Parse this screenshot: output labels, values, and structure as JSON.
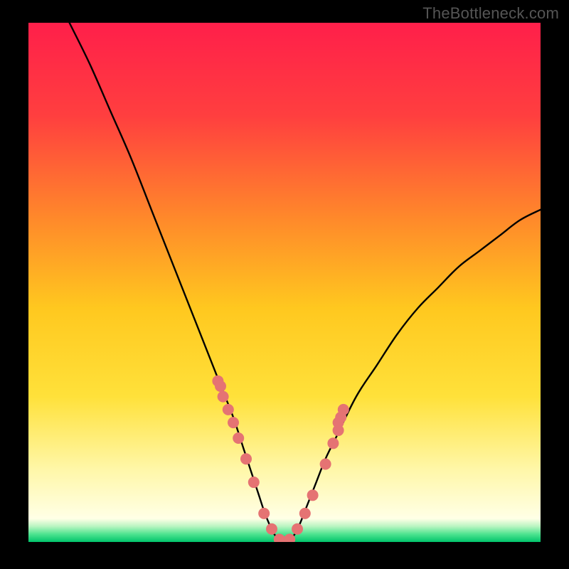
{
  "watermark": "TheBottleneck.com",
  "chart_data": {
    "type": "line",
    "title": "",
    "xlabel": "",
    "ylabel": "",
    "xlim": [
      0,
      100
    ],
    "ylim": [
      0,
      100
    ],
    "gradient_stops": [
      {
        "offset": 0.0,
        "color": "#ff1f4a"
      },
      {
        "offset": 0.18,
        "color": "#ff3f3f"
      },
      {
        "offset": 0.38,
        "color": "#ff8a2a"
      },
      {
        "offset": 0.55,
        "color": "#ffc81f"
      },
      {
        "offset": 0.72,
        "color": "#ffe13a"
      },
      {
        "offset": 0.86,
        "color": "#fff7a8"
      },
      {
        "offset": 0.955,
        "color": "#ffffe6"
      },
      {
        "offset": 0.97,
        "color": "#b8f5c1"
      },
      {
        "offset": 0.985,
        "color": "#4de38f"
      },
      {
        "offset": 1.0,
        "color": "#00c46b"
      }
    ],
    "series": [
      {
        "name": "curve",
        "type": "line",
        "x": [
          8,
          12,
          16,
          20,
          24,
          28,
          32,
          36,
          38,
          40,
          42,
          43,
          44,
          45,
          46,
          47,
          48,
          49,
          50,
          51,
          52,
          53,
          54,
          56,
          58,
          60,
          64,
          68,
          72,
          76,
          80,
          84,
          88,
          92,
          96,
          100
        ],
        "y": [
          100,
          92,
          83,
          74,
          64,
          54,
          44,
          34,
          29,
          24,
          18,
          15,
          12,
          9,
          6,
          3.5,
          1.5,
          0.5,
          0,
          0.5,
          1.5,
          3.5,
          6,
          11,
          16,
          20,
          28,
          34,
          40,
          45,
          49,
          53,
          56,
          59,
          62,
          64
        ]
      },
      {
        "name": "markers",
        "type": "scatter",
        "x": [
          37,
          37.5,
          38,
          39,
          40,
          41,
          42.5,
          44,
          46,
          47.5,
          49,
          50,
          51,
          52.5,
          54,
          55.5,
          58,
          59.5,
          60.5,
          60.5,
          61,
          61.5
        ],
        "y": [
          31,
          30,
          28,
          25.5,
          23,
          20,
          16,
          11.5,
          5.5,
          2.5,
          0.5,
          0,
          0.5,
          2.5,
          5.5,
          9,
          15,
          19,
          21.5,
          23,
          24,
          25.5
        ],
        "marker_color": "#e57373",
        "marker_radius": 8
      }
    ]
  }
}
